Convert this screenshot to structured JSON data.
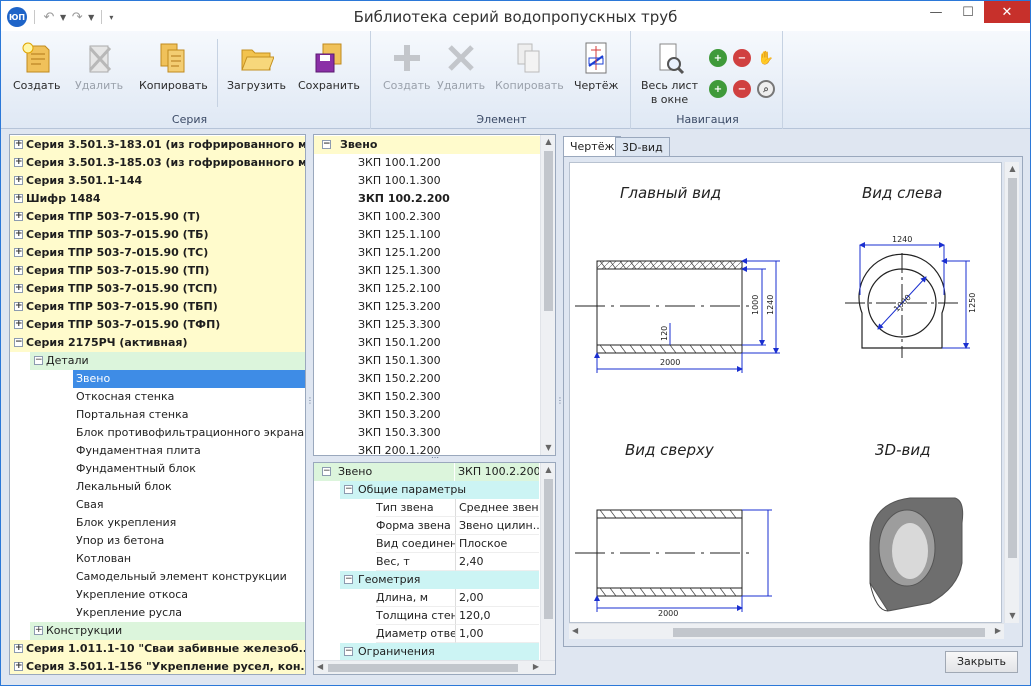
{
  "app": {
    "title": "Библиотека серий водопропускных труб",
    "logo": "ЮП"
  },
  "ribbon": {
    "seria": {
      "label": "Серия",
      "create": "Создать",
      "delete": "Удалить",
      "copy": "Копировать",
      "load": "Загрузить",
      "save": "Сохранить"
    },
    "element": {
      "label": "Элемент",
      "create": "Создать",
      "delete": "Удалить",
      "copy": "Копировать",
      "drawing": "Чертёж"
    },
    "nav": {
      "label": "Навигация",
      "whole_sheet": "Весь лист",
      "in_window": "в окне"
    }
  },
  "series_tree": {
    "series": [
      "Серия 3.501.3-183.01 (из гофрированного м...",
      "Серия 3.501.3-185.03 (из гофрированного м...",
      "Серия 3.501.1-144",
      "Шифр 1484",
      "Серия ТПР 503-7-015.90 (Т)",
      "Серия ТПР 503-7-015.90 (ТБ)",
      "Серия ТПР 503-7-015.90 (ТС)",
      "Серия ТПР 503-7-015.90 (ТП)",
      "Серия ТПР 503-7-015.90 (ТСП)",
      "Серия ТПР 503-7-015.90 (ТБП)",
      "Серия ТПР 503-7-015.90 (ТФП)"
    ],
    "active_series": "Серия 2175РЧ (активная)",
    "details_label": "Детали",
    "details": [
      "Звено",
      "Откосная стенка",
      "Портальная стенка",
      "Блок противофильтрационного экрана",
      "Фундаментная плита",
      "Фундаментный блок",
      "Лекальный блок",
      "Свая",
      "Блок укрепления",
      "Упор из бетона",
      "Котлован",
      "Самодельный элемент конструкции",
      "Укрепление откоса",
      "Укрепление русла"
    ],
    "constructions_label": "Конструкции",
    "bottom_series": [
      "Серия 1.011.1-10 \"Сваи забивные железоб...",
      "Серия 3.501.1-156 \"Укрепление русел, кон..."
    ]
  },
  "elements_list": {
    "header": "Звено",
    "items": [
      "ЗКП 100.1.200",
      "ЗКП 100.1.300",
      "ЗКП 100.2.200",
      "ЗКП 100.2.300",
      "ЗКП 125.1.100",
      "ЗКП 125.1.200",
      "ЗКП 125.1.300",
      "ЗКП 125.2.100",
      "ЗКП 125.3.200",
      "ЗКП 125.3.300",
      "ЗКП 150.1.200",
      "ЗКП 150.1.300",
      "ЗКП 150.2.200",
      "ЗКП 150.2.300",
      "ЗКП 150.3.200",
      "ЗКП 150.3.300",
      "ЗКП 200.1.200"
    ],
    "selected": "ЗКП 100.2.200"
  },
  "properties": {
    "root": {
      "name": "Звено",
      "value": "ЗКП 100.2.200"
    },
    "general": {
      "label": "Общие параметры",
      "rows": [
        {
          "name": "Тип звена",
          "value": "Среднее звено"
        },
        {
          "name": "Форма звена",
          "value": "Звено цилин..."
        },
        {
          "name": "Вид соединени",
          "value": "Плоское"
        },
        {
          "name": "Вес, т",
          "value": "2,40"
        }
      ]
    },
    "geometry": {
      "label": "Геометрия",
      "rows": [
        {
          "name": "Длина, м",
          "value": "2,00"
        },
        {
          "name": "Толщина стенк",
          "value": "120,0"
        },
        {
          "name": "Диаметр отвер",
          "value": "1,00"
        }
      ]
    },
    "limits": {
      "label": "Ограничения"
    }
  },
  "tabs": {
    "drawing": "Чертёж",
    "view3d": "3D-вид"
  },
  "drawing": {
    "views": {
      "main": "Главный вид",
      "left": "Вид слева",
      "top": "Вид сверху",
      "iso": "3D-вид"
    },
    "dims": {
      "length": "2000",
      "inner_h": "1000",
      "outer_h": "1240",
      "wall": "120",
      "width": "1240",
      "diameter": "1000",
      "height_left": "1250"
    }
  },
  "footer": {
    "close": "Закрыть"
  },
  "colors": {
    "accent": "#3e8ce6",
    "series_bg": "#fffbcc",
    "detail_bg": "#dcf5dc",
    "group_bg": "#ccf4f4",
    "dim_blue": "#1a2fd0",
    "close": "#c7302b"
  }
}
